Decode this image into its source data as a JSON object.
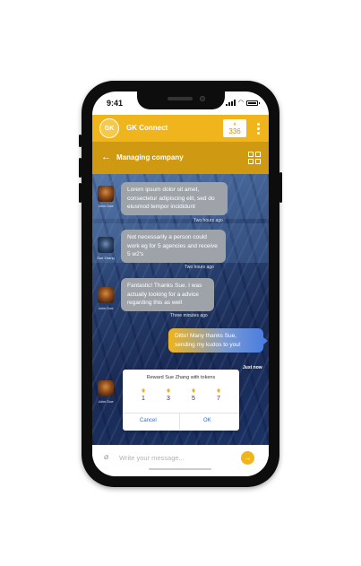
{
  "status_bar": {
    "time": "9:41"
  },
  "header": {
    "app_name": "GK Connect",
    "logo_text": "GK",
    "token_count": "336"
  },
  "subheader": {
    "title": "Managing company"
  },
  "messages": [
    {
      "sender": "John Doe",
      "text": "Lorem ipsum dolor sit amet, consectetur adipiscing elit, sed do eiusmod tempor incididunt",
      "time": "Two hours ago"
    },
    {
      "sender": "Sue Zhang",
      "text": "Not necessarily a person could work eg for 5 agencies and receive 5 w2's",
      "time": "Two hours ago"
    },
    {
      "sender": "John Doe",
      "text": "Fantastic! Thanks Sue. I was actually looking for a advice regarding this as well",
      "time": "Three minutes ago"
    },
    {
      "sender": "me",
      "text": "Ditto! Many thanks Sue, sending my kudos to you!",
      "time": "Just now"
    }
  ],
  "reward_card": {
    "sender": "John Doe",
    "title": "Reward Sue Zhang with tokens",
    "options": [
      "1",
      "3",
      "5",
      "7"
    ],
    "cancel_label": "Cancel",
    "ok_label": "OK"
  },
  "composer": {
    "placeholder": "Write your message..."
  },
  "colors": {
    "accent": "#f0b41c",
    "accent_dark": "#cf9a12",
    "link": "#2d6dd2",
    "bubble_gray": "#9ea3aa"
  }
}
